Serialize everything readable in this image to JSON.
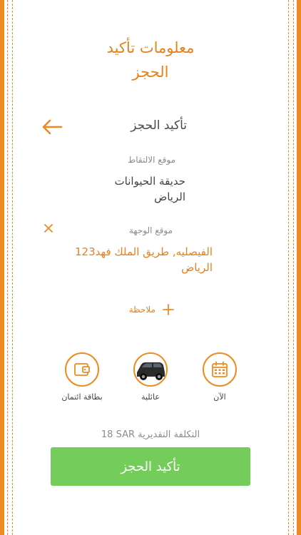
{
  "heading": {
    "line1": "معلومات تأكيد",
    "line2": "الحجز"
  },
  "header": {
    "title": "تأكيد الحجز"
  },
  "pickup": {
    "label": "موقع الالتقاط",
    "line1": "حديقة الحيوانات",
    "line2": "الرياض"
  },
  "destination": {
    "label": "موقع الوجهة",
    "line1": "123الفيصليه, طريق الملك فهد",
    "line2": "الرياض"
  },
  "note": {
    "label": "ملاحظة"
  },
  "options": {
    "payment": {
      "label": "بطاقة ائتمان",
      "icon": "wallet-icon"
    },
    "car": {
      "label": "عائلية",
      "icon": "car-icon"
    },
    "time": {
      "label": "الآن",
      "icon": "calendar-icon"
    }
  },
  "cost": {
    "label": "التكلفة التقديرية",
    "value": "18 SAR"
  },
  "confirm_button": {
    "label": "تأكيد الحجز"
  },
  "colors": {
    "accent": "#ee8a1f",
    "button": "#74cd5a"
  }
}
